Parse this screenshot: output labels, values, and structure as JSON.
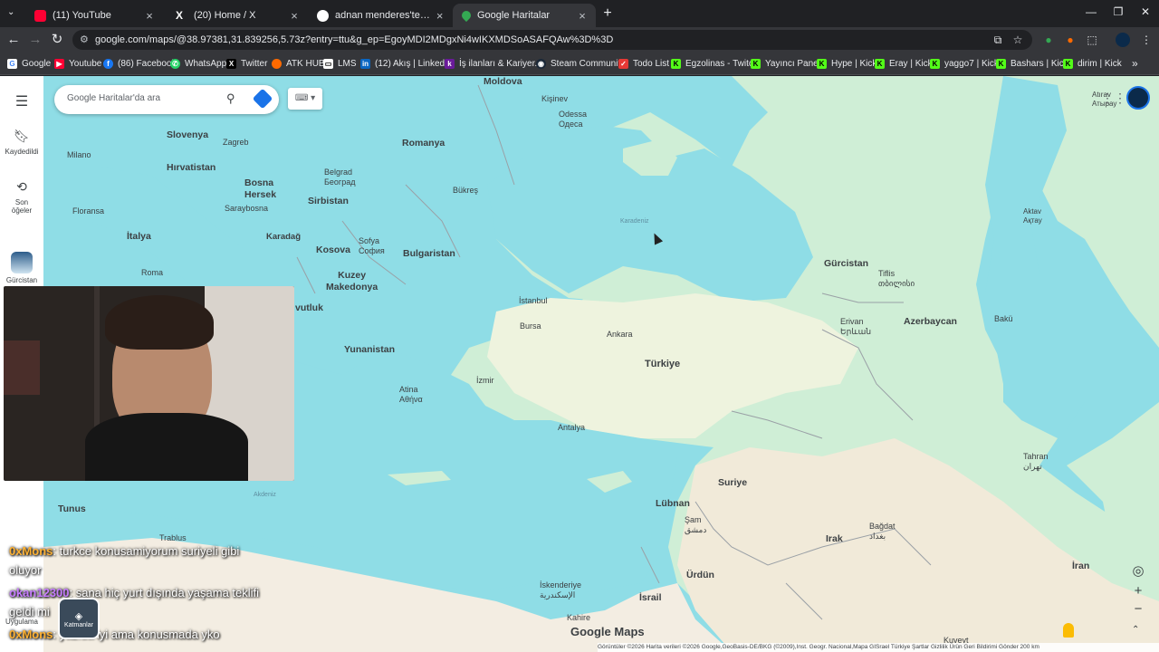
{
  "browser": {
    "tabs": [
      {
        "title": "(11) YouTube",
        "icon": "youtube-icon",
        "color": "#ff0033"
      },
      {
        "title": "(20) Home / X",
        "icon": "x-icon",
        "color": "#ffffff"
      },
      {
        "title": "adnan menderes'ten sonraki c...",
        "icon": "google-icon",
        "color": "#ffffff"
      },
      {
        "title": "Google Haritalar",
        "icon": "google-maps-icon",
        "color": "#34a853"
      }
    ],
    "url": "google.com/maps/@38.97381,31.839256,5.73z?entry=ttu&g_ep=EgoyMDI2MDgxNi4wIKXMDSoASAFQAw%3D%3D",
    "bookmarks": [
      {
        "label": "Google",
        "color": "#4285f4"
      },
      {
        "label": "Youtube",
        "color": "#ff0033"
      },
      {
        "label": "(86) Facebook",
        "color": "#1877f2"
      },
      {
        "label": "WhatsApp",
        "color": "#25d366"
      },
      {
        "label": "Twitter",
        "color": "#000000"
      },
      {
        "label": "ATK HUB",
        "color": "#ff6a00"
      },
      {
        "label": "LMS",
        "color": "#ffffff"
      },
      {
        "label": "(12) Akış | LinkedIn",
        "color": "#0a66c2"
      },
      {
        "label": "İş ilanları & Kariyer...",
        "color": "#6a1b9a"
      },
      {
        "label": "Steam Community",
        "color": "#1b2838"
      },
      {
        "label": "Todo List",
        "color": "#e53935"
      },
      {
        "label": "Egzolinas - Twitch",
        "color": "#53fc18"
      },
      {
        "label": "Yayıncı Paneli",
        "color": "#53fc18"
      },
      {
        "label": "Hype | Kick",
        "color": "#53fc18"
      },
      {
        "label": "Eray | Kick",
        "color": "#53fc18"
      },
      {
        "label": "yaggo7 | Kick",
        "color": "#53fc18"
      },
      {
        "label": "Bashars | Kick",
        "color": "#53fc18"
      },
      {
        "label": "dirim | Kick",
        "color": "#53fc18"
      }
    ]
  },
  "maps": {
    "search_placeholder": "Google Haritalar'da ara",
    "sidebar": {
      "saved": "Kaydedildi",
      "recent": "Son öğeler",
      "recent_place": "Gürcistan",
      "apps": "Uygulama"
    },
    "layers_label": "Katmanlar",
    "logo": "Google Maps",
    "footer": "Görüntüler ©2026 Harita verileri ©2026 Google,GeoBasis-DE/BKG (©2009),Inst. Geogr. Nacional,Mapa GISrael    Türkiye    Şartlar    Gizlilik    Ürün Geri Bildirimi Gönder    200 km",
    "labels": {
      "countries": [
        {
          "id": "moldova",
          "text": "Moldova"
        },
        {
          "id": "romanya",
          "text": "Romanya"
        },
        {
          "id": "slovenya",
          "text": "Slovenya"
        },
        {
          "id": "hirvatistan",
          "text": "Hırvatistan"
        },
        {
          "id": "bosna",
          "text": "Bosna\nHersek"
        },
        {
          "id": "sirbistan",
          "text": "Sirbistan"
        },
        {
          "id": "italya",
          "text": "İtalya"
        },
        {
          "id": "kosova",
          "text": "Kosova"
        },
        {
          "id": "bulgaristan",
          "text": "Bulgaristan"
        },
        {
          "id": "kuzey",
          "text": "Kuzey\nMakedonya"
        },
        {
          "id": "yunanistan",
          "text": "Yunanistan"
        },
        {
          "id": "turkiye",
          "text": "Türkiye"
        },
        {
          "id": "gurcistan",
          "text": "Gürcistan"
        },
        {
          "id": "azerbaycan",
          "text": "Azerbaycan"
        },
        {
          "id": "suriye",
          "text": "Suriye"
        },
        {
          "id": "lubnan",
          "text": "Lübnan"
        },
        {
          "id": "irak",
          "text": "Irak"
        },
        {
          "id": "iran",
          "text": "İran"
        },
        {
          "id": "urdun",
          "text": "Ürdün"
        },
        {
          "id": "israil",
          "text": "İsrail"
        },
        {
          "id": "tunus",
          "text": "Tunus"
        },
        {
          "id": "karadag",
          "text": "Karadağ"
        },
        {
          "id": "arnavutluk",
          "text": "vutluk"
        }
      ],
      "cities": [
        {
          "id": "odessa",
          "text": "Odessa\nОдеса"
        },
        {
          "id": "kisinev",
          "text": "Kişinev"
        },
        {
          "id": "zagreb",
          "text": "Zagreb"
        },
        {
          "id": "milano",
          "text": "Milano"
        },
        {
          "id": "floransa",
          "text": "Floransa"
        },
        {
          "id": "roma",
          "text": "Roma"
        },
        {
          "id": "saraybosna",
          "text": "Saraybosna"
        },
        {
          "id": "belgrad",
          "text": "Belgrad\nБеоград"
        },
        {
          "id": "bukres",
          "text": "Bükreş"
        },
        {
          "id": "sofya",
          "text": "Sofya\nСофия"
        },
        {
          "id": "istanbul",
          "text": "İstanbul"
        },
        {
          "id": "bursa",
          "text": "Bursa"
        },
        {
          "id": "ankara",
          "text": "Ankara"
        },
        {
          "id": "izmir",
          "text": "İzmir"
        },
        {
          "id": "atina",
          "text": "Atina\nΑθήνα"
        },
        {
          "id": "antalya",
          "text": "Antalya"
        },
        {
          "id": "tiflis",
          "text": "Tiflis\nთბილისი"
        },
        {
          "id": "erivan",
          "text": "Erivan\nԵրևան"
        },
        {
          "id": "baku",
          "text": "Bakü"
        },
        {
          "id": "aktav",
          "text": "Aktav\nАқтау"
        },
        {
          "id": "atirav",
          "text": "Atırav\nАтырау"
        },
        {
          "id": "tahran",
          "text": "Tahran\nتهران"
        },
        {
          "id": "bagdat",
          "text": "Bağdat\nبغداد"
        },
        {
          "id": "sam",
          "text": "Şam\nدمشق"
        },
        {
          "id": "iskenderiye",
          "text": "İskenderiye\nالإسكندرية"
        },
        {
          "id": "kahire",
          "text": "Kahire"
        },
        {
          "id": "trablus",
          "text": "Trablus"
        },
        {
          "id": "kuveyt",
          "text": "Kuveyt"
        }
      ],
      "seas": [
        {
          "id": "karadeniz",
          "text": "Karadeniz"
        },
        {
          "id": "akdeniz",
          "text": "Akdeniz"
        }
      ]
    }
  },
  "chat": [
    {
      "nick": "0xMons",
      "msg": ": turkce konusamiyorum suriyeli gibi",
      "cont": "oluyor"
    },
    {
      "nick": "okan12300",
      "msg": ": sana hiç yurt dışında yaşama teklifi",
      "cont": "geldi mi"
    },
    {
      "nick": "0xMons",
      "msg": ": yazida iyi ama konusmada yko",
      "cont": ""
    }
  ]
}
